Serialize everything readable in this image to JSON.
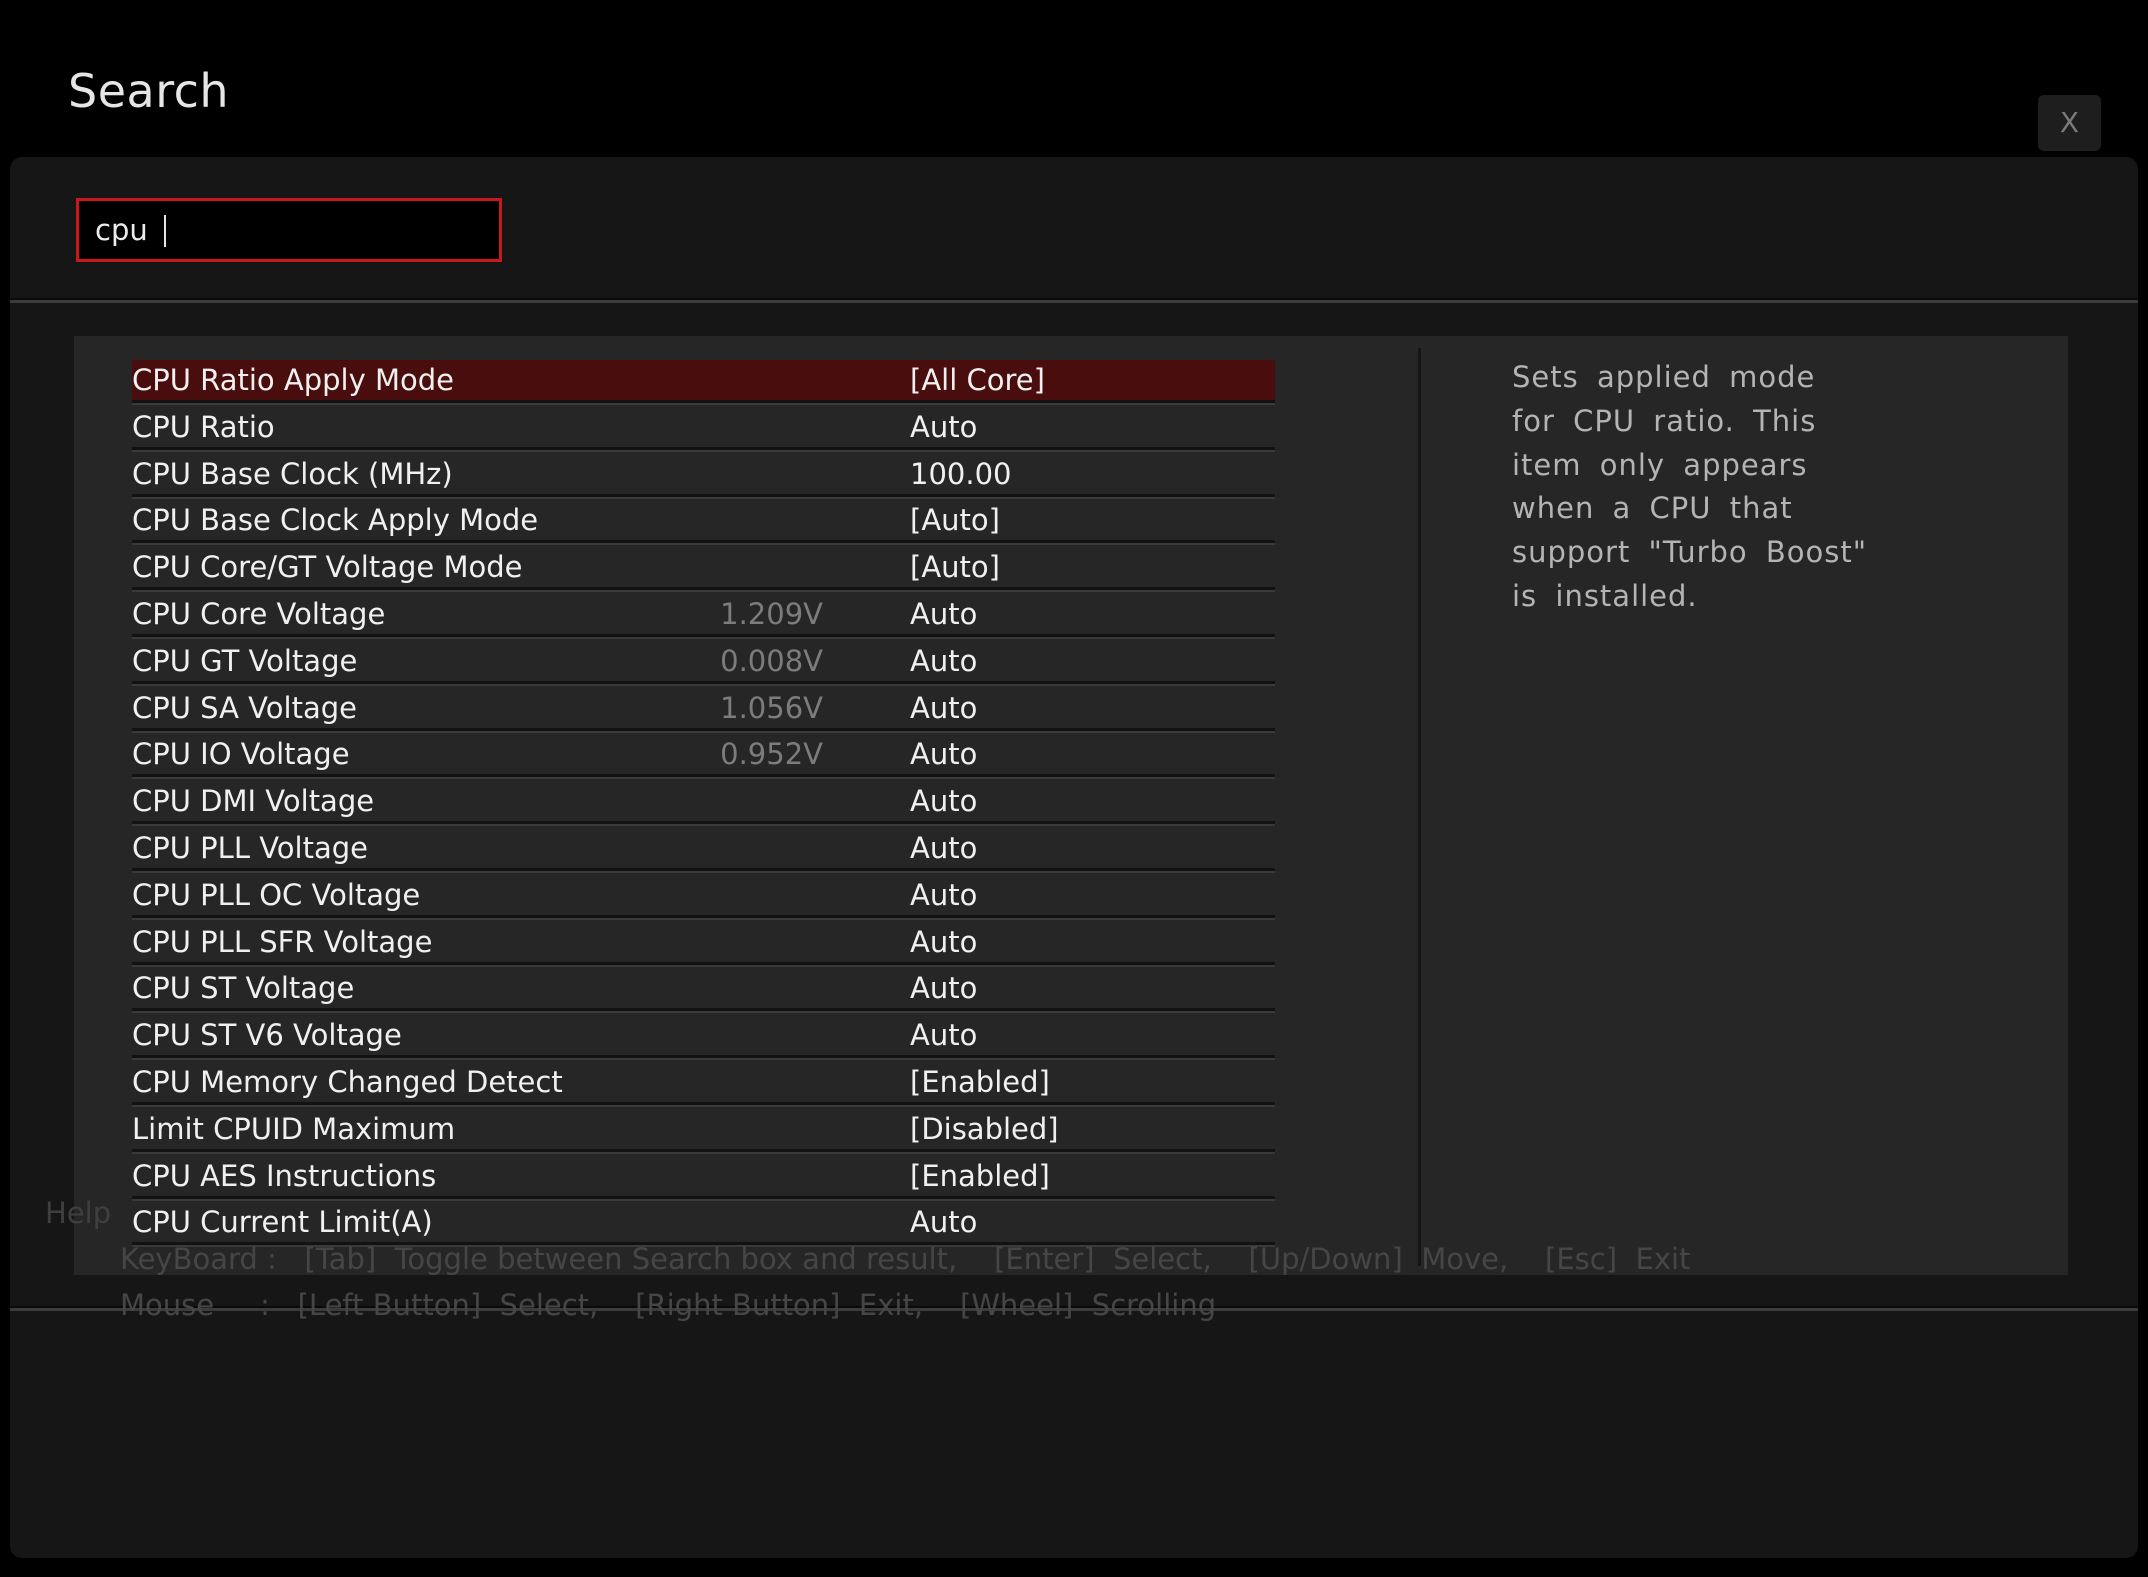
{
  "window": {
    "title": "Search",
    "close_label": "X"
  },
  "search": {
    "value": "cpu",
    "placeholder": ""
  },
  "results": {
    "selected_index": 0,
    "items": [
      {
        "name": "CPU Ratio Apply Mode",
        "reading": "",
        "value": "[All Core]"
      },
      {
        "name": "CPU Ratio",
        "reading": "",
        "value": "Auto"
      },
      {
        "name": "CPU Base Clock (MHz)",
        "reading": "",
        "value": "100.00"
      },
      {
        "name": "CPU Base Clock Apply Mode",
        "reading": "",
        "value": "[Auto]"
      },
      {
        "name": "CPU Core/GT Voltage Mode",
        "reading": "",
        "value": "[Auto]"
      },
      {
        "name": "CPU Core Voltage",
        "reading": "1.209V",
        "value": "Auto"
      },
      {
        "name": "CPU GT Voltage",
        "reading": "0.008V",
        "value": "Auto"
      },
      {
        "name": "CPU SA Voltage",
        "reading": "1.056V",
        "value": "Auto"
      },
      {
        "name": "CPU IO Voltage",
        "reading": "0.952V",
        "value": "Auto"
      },
      {
        "name": "CPU DMI Voltage",
        "reading": "",
        "value": "Auto"
      },
      {
        "name": "CPU PLL Voltage",
        "reading": "",
        "value": "Auto"
      },
      {
        "name": "CPU PLL OC Voltage",
        "reading": "",
        "value": "Auto"
      },
      {
        "name": "CPU PLL SFR Voltage",
        "reading": "",
        "value": "Auto"
      },
      {
        "name": "CPU ST Voltage",
        "reading": "",
        "value": "Auto"
      },
      {
        "name": "CPU ST V6 Voltage",
        "reading": "",
        "value": "Auto"
      },
      {
        "name": "CPU Memory Changed Detect",
        "reading": "",
        "value": "[Enabled]"
      },
      {
        "name": "Limit CPUID Maximum",
        "reading": "",
        "value": "[Disabled]"
      },
      {
        "name": "CPU AES Instructions",
        "reading": "",
        "value": "[Enabled]"
      },
      {
        "name": "CPU Current Limit(A)",
        "reading": "",
        "value": "Auto"
      }
    ]
  },
  "description": {
    "text": "Sets applied mode for CPU ratio. This item only appears when a CPU that support \"Turbo Boost\" is installed."
  },
  "help": {
    "title": "Help",
    "keyboard_line": "KeyBoard :   [Tab]  Toggle between Search box and result,    [Enter]  Select,    [Up/Down]  Move,    [Esc]  Exit",
    "mouse_line": "Mouse     :   [Left Button]  Select,    [Right Button]  Exit,    [Wheel]  Scrolling"
  },
  "colors": {
    "accent_border": "#c8181c",
    "selected_row": "#4a0d0e"
  }
}
